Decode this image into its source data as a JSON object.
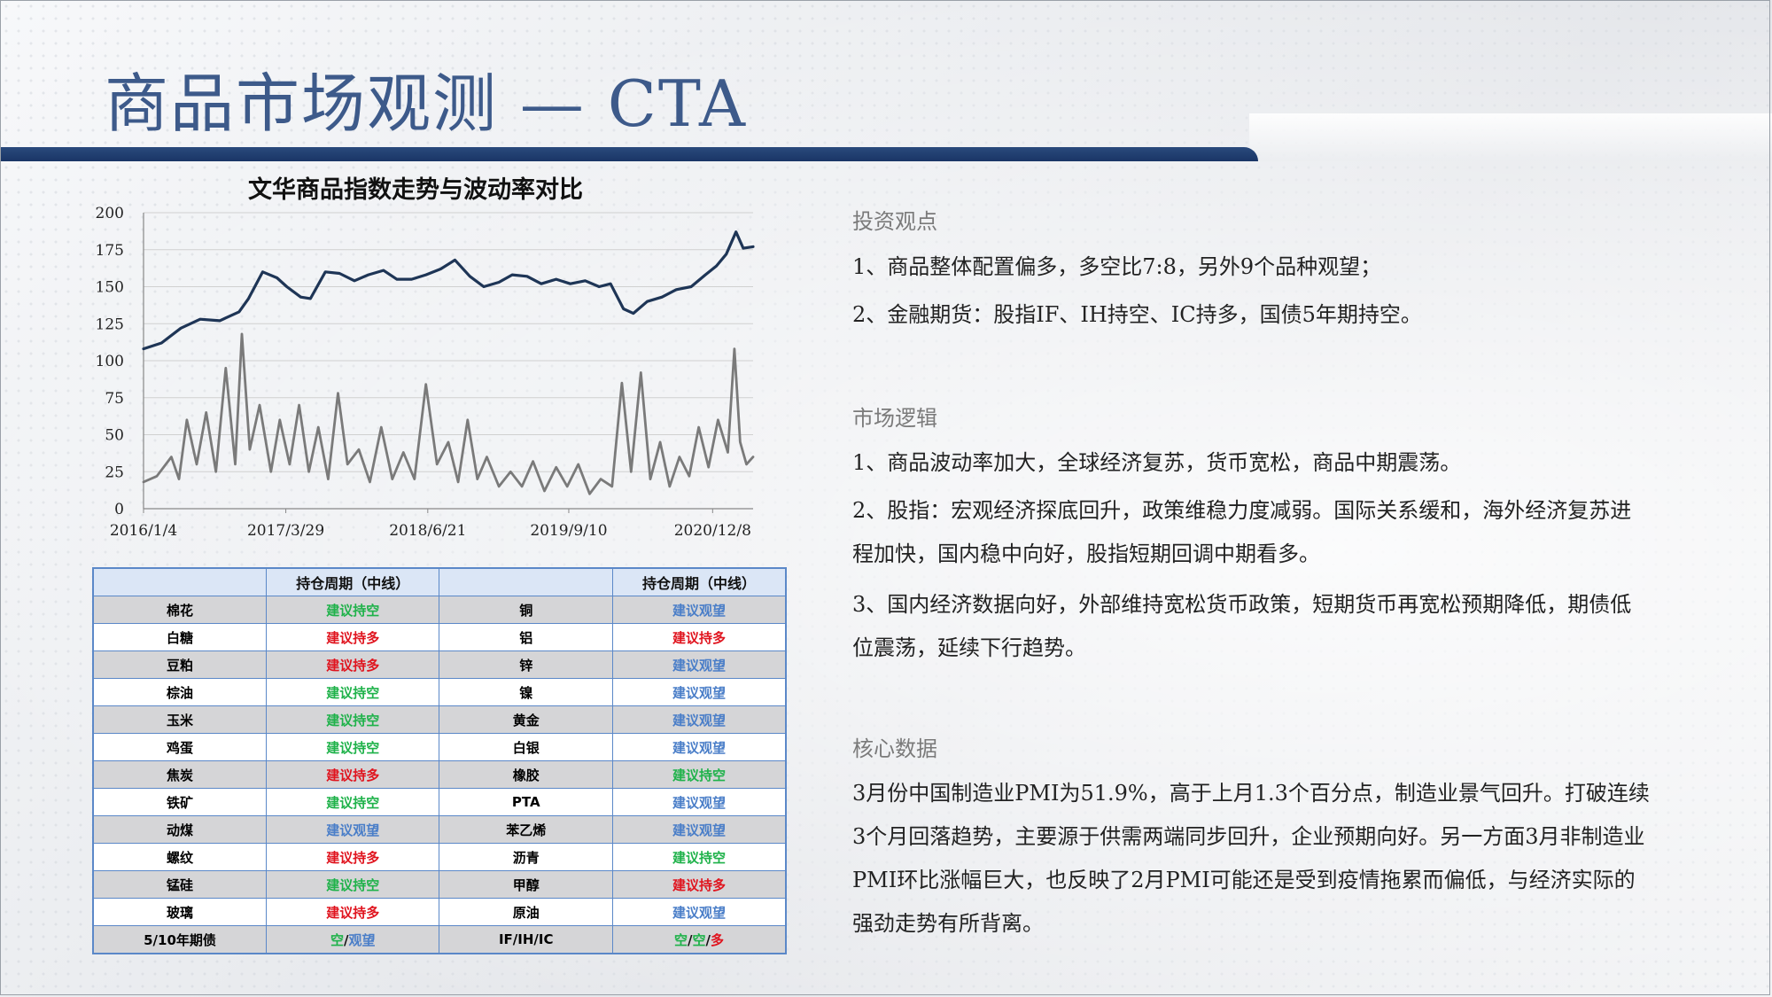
{
  "title": "商品市场观测 — CTA",
  "chart_data": {
    "type": "line",
    "title": "文华商品指数走势与波动率对比",
    "x_tick_labels": [
      "2016/1/4",
      "2017/3/29",
      "2018/6/21",
      "2019/9/10",
      "2020/12/8"
    ],
    "y_tick_labels": [
      "0",
      "25",
      "50",
      "75",
      "100",
      "125",
      "150",
      "175",
      "200"
    ],
    "ylim": [
      0,
      200
    ],
    "x_range": [
      "2016/1/4",
      "2021/4/15"
    ],
    "series": [
      {
        "color": "#1e3556",
        "x": [
          "2016/1/4",
          "2016/3/1",
          "2016/5/1",
          "2016/7/1",
          "2016/9/1",
          "2016/11/1",
          "2016/12/1",
          "2017/1/15",
          "2017/3/1",
          "2017/4/1",
          "2017/5/15",
          "2017/6/15",
          "2017/8/1",
          "2017/9/15",
          "2017/11/1",
          "2017/12/15",
          "2018/2/1",
          "2018/3/15",
          "2018/5/1",
          "2018/6/15",
          "2018/8/1",
          "2018/9/15",
          "2018/11/1",
          "2018/12/15",
          "2019/2/1",
          "2019/3/15",
          "2019/5/1",
          "2019/6/15",
          "2019/8/1",
          "2019/9/15",
          "2019/11/1",
          "2019/12/15",
          "2020/1/20",
          "2020/3/1",
          "2020/4/1",
          "2020/5/15",
          "2020/7/1",
          "2020/8/15",
          "2020/10/1",
          "2020/11/15",
          "2020/12/20",
          "2021/1/20",
          "2021/2/20",
          "2021/3/15",
          "2021/4/15"
        ],
        "values": [
          108,
          112,
          122,
          128,
          127,
          133,
          142,
          160,
          156,
          150,
          143,
          142,
          160,
          159,
          154,
          158,
          161,
          155,
          155,
          158,
          162,
          168,
          157,
          150,
          153,
          158,
          157,
          152,
          155,
          152,
          154,
          150,
          152,
          135,
          132,
          140,
          143,
          148,
          150,
          158,
          164,
          172,
          187,
          176,
          177
        ]
      },
      {
        "color": "#7a7a7a",
        "x": [
          "2016/1/4",
          "2016/2/15",
          "2016/4/1",
          "2016/4/25",
          "2016/5/20",
          "2016/6/20",
          "2016/7/20",
          "2016/8/20",
          "2016/9/20",
          "2016/10/20",
          "2016/11/10",
          "2016/12/5",
          "2017/1/5",
          "2017/2/10",
          "2017/3/10",
          "2017/4/10",
          "2017/5/10",
          "2017/6/10",
          "2017/7/10",
          "2017/8/10",
          "2017/9/10",
          "2017/10/10",
          "2017/11/15",
          "2017/12/20",
          "2018/1/25",
          "2018/3/1",
          "2018/4/5",
          "2018/5/10",
          "2018/6/15",
          "2018/7/20",
          "2018/8/25",
          "2018/9/25",
          "2018/10/25",
          "2018/11/25",
          "2018/12/25",
          "2019/2/1",
          "2019/3/10",
          "2019/4/15",
          "2019/5/20",
          "2019/6/25",
          "2019/8/1",
          "2019/9/5",
          "2019/10/10",
          "2019/11/15",
          "2019/12/20",
          "2020/1/25",
          "2020/2/25",
          "2020/3/25",
          "2020/4/25",
          "2020/5/25",
          "2020/6/25",
          "2020/7/25",
          "2020/8/25",
          "2020/9/25",
          "2020/10/25",
          "2020/11/25",
          "2020/12/25",
          "2021/1/25",
          "2021/2/15",
          "2021/3/5",
          "2021/3/25",
          "2021/4/15"
        ],
        "values": [
          18,
          22,
          35,
          20,
          60,
          30,
          65,
          25,
          95,
          30,
          118,
          40,
          70,
          25,
          60,
          30,
          70,
          25,
          55,
          20,
          78,
          30,
          40,
          18,
          55,
          20,
          38,
          20,
          84,
          30,
          45,
          18,
          60,
          20,
          35,
          15,
          25,
          15,
          32,
          12,
          28,
          15,
          30,
          10,
          20,
          15,
          85,
          25,
          92,
          20,
          45,
          15,
          35,
          22,
          55,
          28,
          60,
          38,
          108,
          45,
          30,
          35
        ]
      }
    ],
    "grid": true,
    "legend": "none"
  },
  "table": {
    "headers": [
      "",
      "持仓周期（中线）",
      "",
      "持仓周期（中线）"
    ],
    "rows": [
      {
        "left": "棉花",
        "left_view": "建议持空",
        "left_color": "green",
        "right": "铜",
        "right_view": "建议观望",
        "right_color": "blue"
      },
      {
        "left": "白糖",
        "left_view": "建议持多",
        "left_color": "red",
        "right": "铝",
        "right_view": "建议持多",
        "right_color": "red"
      },
      {
        "left": "豆粕",
        "left_view": "建议持多",
        "left_color": "red",
        "right": "锌",
        "right_view": "建议观望",
        "right_color": "blue"
      },
      {
        "left": "棕油",
        "left_view": "建议持空",
        "left_color": "green",
        "right": "镍",
        "right_view": "建议观望",
        "right_color": "blue"
      },
      {
        "left": "玉米",
        "left_view": "建议持空",
        "left_color": "green",
        "right": "黄金",
        "right_view": "建议观望",
        "right_color": "blue"
      },
      {
        "left": "鸡蛋",
        "left_view": "建议持空",
        "left_color": "green",
        "right": "白银",
        "right_view": "建议观望",
        "right_color": "blue"
      },
      {
        "left": "焦炭",
        "left_view": "建议持多",
        "left_color": "red",
        "right": "橡胶",
        "right_view": "建议持空",
        "right_color": "green"
      },
      {
        "left": "铁矿",
        "left_view": "建议持空",
        "left_color": "green",
        "right": "PTA",
        "right_view": "建议观望",
        "right_color": "blue"
      },
      {
        "left": "动煤",
        "left_view": "建议观望",
        "left_color": "blue",
        "right": "苯乙烯",
        "right_view": "建议观望",
        "right_color": "blue"
      },
      {
        "left": "螺纹",
        "left_view": "建议持多",
        "left_color": "red",
        "right": "沥青",
        "right_view": "建议持空",
        "right_color": "green"
      },
      {
        "left": "锰硅",
        "left_view": "建议持空",
        "left_color": "green",
        "right": "甲醇",
        "right_view": "建议持多",
        "right_color": "red"
      },
      {
        "left": "玻璃",
        "left_view": "建议持多",
        "left_color": "red",
        "right": "原油",
        "right_view": "建议观望",
        "right_color": "blue"
      }
    ],
    "last_row": {
      "left": "5/10年期债",
      "left_parts": [
        {
          "text": "空",
          "color": "green"
        },
        {
          "text": "/",
          "color": "dark"
        },
        {
          "text": "观望",
          "color": "blue"
        }
      ],
      "right": "IF/IH/IC",
      "right_parts": [
        {
          "text": "空",
          "color": "green"
        },
        {
          "text": "/",
          "color": "dark"
        },
        {
          "text": "空",
          "color": "green"
        },
        {
          "text": "/",
          "color": "dark"
        },
        {
          "text": "多",
          "color": "red"
        }
      ]
    }
  },
  "sections": {
    "view": {
      "heading": "投资观点",
      "p1": "1、商品整体配置偏多，多空比7:8，另外9个品种观望；",
      "p2": "2、金融期货：股指IF、IH持空、IC持多，国债5年期持空。"
    },
    "logic": {
      "heading": "市场逻辑",
      "p1": "1、商品波动率加大，全球经济复苏，货币宽松，商品中期震荡。",
      "p2": "2、股指：宏观经济探底回升，政策维稳力度减弱。国际关系缓和，海外经济复苏进程加快，国内稳中向好，股指短期回调中期看多。",
      "p3": "3、国内经济数据向好，外部维持宽松货币政策，短期货币再宽松预期降低，期债低位震荡，延续下行趋势。"
    },
    "core": {
      "heading": "核心数据",
      "p1": "3月份中国制造业PMI为51.9%，高于上月1.3个百分点，制造业景气回升。打破连续3个月回落趋势，主要源于供需两端同步回升，企业预期向好。另一方面3月非制造业PMI环比涨幅巨大，也反映了2月PMI可能还是受到疫情拖累而偏低，与经济实际的强劲走势有所背离。"
    }
  }
}
